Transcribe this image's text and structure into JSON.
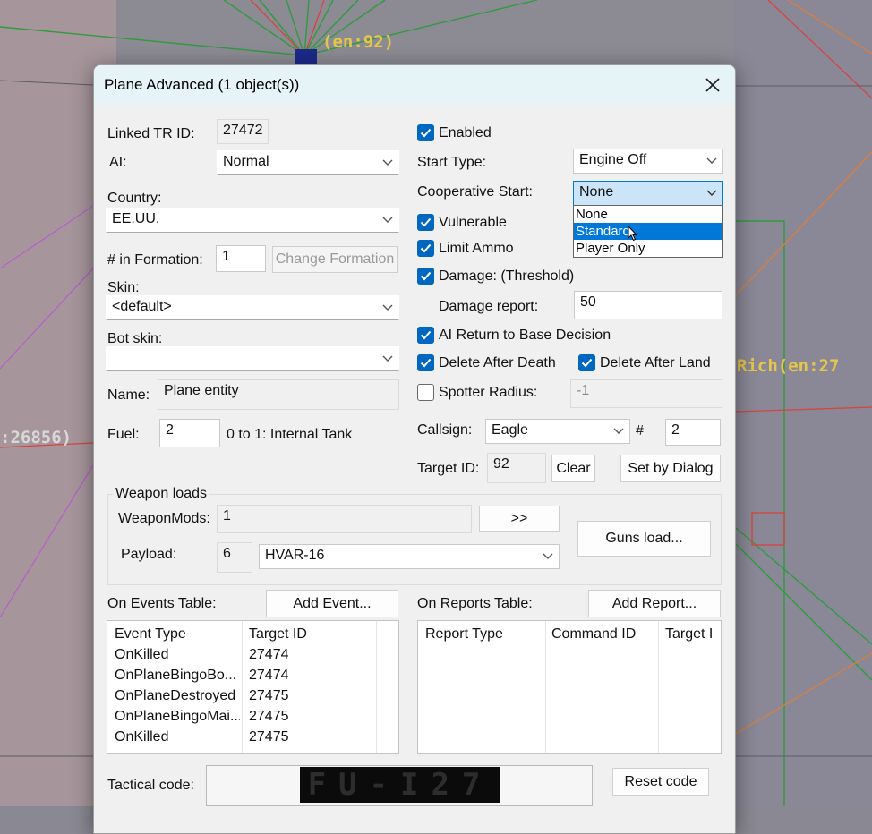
{
  "window": {
    "title": "Plane Advanced (1 object(s))"
  },
  "map_labels": {
    "top": "(en:92)",
    "right": "Rich(en:27",
    "left": ":26856)"
  },
  "left": {
    "linked_tr_id_label": "Linked TR ID:",
    "linked_tr_id_value": "27472",
    "ai_label": "AI:",
    "ai_value": "Normal",
    "country_label": "Country:",
    "country_value": "EE.UU.",
    "formation_label": "# in Formation:",
    "formation_value": "1",
    "change_formation_label": "Change Formation",
    "skin_label": "Skin:",
    "skin_value": "<default>",
    "bot_skin_label": "Bot skin:",
    "bot_skin_value": "",
    "name_label": "Name:",
    "name_value": "Plane entity",
    "fuel_label": "Fuel:",
    "fuel_value": "2",
    "fuel_hint": "0 to 1: Internal Tank"
  },
  "right": {
    "enabled_label": "Enabled",
    "start_type_label": "Start Type:",
    "start_type_value": "Engine Off",
    "coop_start_label": "Cooperative Start:",
    "coop_start_value": "None",
    "coop_options": [
      "None",
      "Standard",
      "Player Only"
    ],
    "vulnerable_label": "Vulnerable",
    "limit_ammo_label": "Limit Ammo",
    "damage_label": "Damage: (Threshold)",
    "damage_report_label": "Damage report:",
    "damage_report_value": "50",
    "ai_return_label": "AI Return to Base Decision",
    "delete_after_death_label": "Delete After Death",
    "delete_after_land_label": "Delete After Land",
    "spotter_radius_label": "Spotter Radius:",
    "spotter_radius_value": "-1",
    "callsign_label": "Callsign:",
    "callsign_value": "Eagle",
    "callsign_num_label": "#",
    "callsign_num_value": "2",
    "target_id_label": "Target ID:",
    "target_id_value": "92",
    "clear_label": "Clear",
    "set_by_dialog_label": "Set by Dialog"
  },
  "weapons": {
    "group_label": "Weapon loads",
    "weaponmods_label": "WeaponMods:",
    "weaponmods_value": "1",
    "more_label": ">>",
    "payload_label": "Payload:",
    "payload_num": "6",
    "payload_value": "HVAR-16",
    "guns_load_label": "Guns load..."
  },
  "events": {
    "label": "On Events Table:",
    "add_label": "Add Event...",
    "columns": [
      "Event Type",
      "Target ID"
    ],
    "rows": [
      [
        "OnKilled",
        "27474"
      ],
      [
        "OnPlaneBingoBo...",
        "27474"
      ],
      [
        "OnPlaneDestroyed",
        "27475"
      ],
      [
        "OnPlaneBingoMai...",
        "27475"
      ],
      [
        "OnKilled",
        "27475"
      ]
    ]
  },
  "reports": {
    "label": "On Reports Table:",
    "add_label": "Add Report...",
    "columns": [
      "Report Type",
      "Command ID",
      "Target I"
    ]
  },
  "tactical": {
    "label": "Tactical code:",
    "code": "FU-I27",
    "reset_label": "Reset code"
  },
  "colors": {
    "accent": "#0067c0",
    "title_bg": "#e6f4f7",
    "dialog_bg": "#f0f0f0",
    "map_label": "#e6c64a"
  }
}
